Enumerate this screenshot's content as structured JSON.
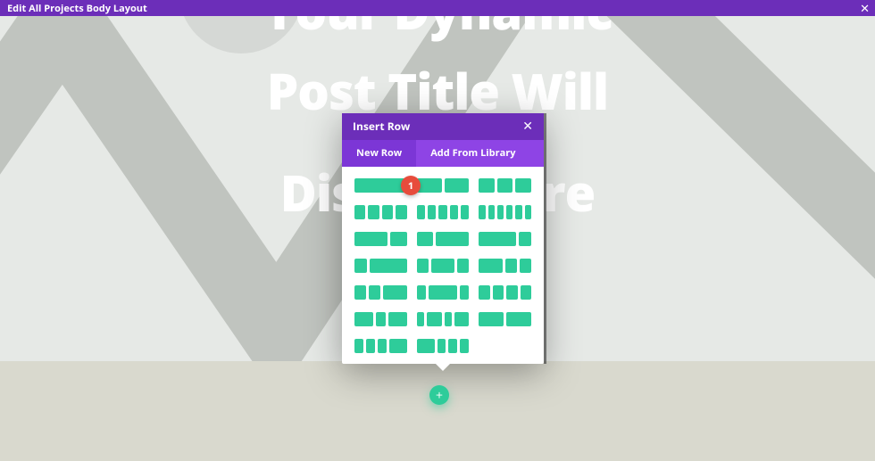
{
  "topbar": {
    "title": "Edit All Projects Body Layout",
    "close_glyph": "✕"
  },
  "hero": {
    "line1": "Your Dynamic",
    "line2": "Post Title Will",
    "line3": "Display Here"
  },
  "modal": {
    "title": "Insert Row",
    "close_glyph": "✕",
    "tabs": {
      "new_row": "New Row",
      "add_from_library": "Add From Library"
    }
  },
  "badge": {
    "number": "1"
  },
  "add_button": {
    "glyph": "+"
  }
}
